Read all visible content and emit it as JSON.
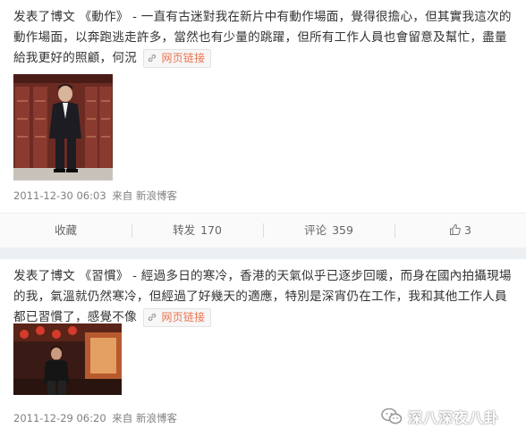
{
  "posts": [
    {
      "text": "发表了博文 《動作》 - 一直有古迷對我在新片中有動作場面，覺得很擔心，但其實我這次的動作場面，以奔跑逃走許多，當然也有少量的跳躍，但所有工作人員也會留意及幫忙，盡量給我更好的照顧，何況",
      "link_label": "网页链接",
      "timestamp": "2011-12-30 06:03",
      "source": "来自 新浪博客"
    },
    {
      "text": "发表了博文 《習慣》 - 經過多日的寒冷，香港的天氣似乎已逐步回暖，而身在國內拍攝現場的我，氣溫就仍然寒冷，但經過了好幾天的適應，特別是深宵仍在工作，我和其他工作人員都已習慣了，感覺不像",
      "link_label": "网页链接",
      "timestamp": "2011-12-29 06:20",
      "source": "来自 新浪博客"
    }
  ],
  "actions": {
    "favorite_label": "收藏",
    "repost_label": "转发",
    "repost_count": "170",
    "comment_label": "评论",
    "comment_count": "359",
    "like_count": "3"
  },
  "watermark": {
    "text": "深八深夜八卦"
  },
  "colors": {
    "link_accent": "#eb7350",
    "meta_gray": "#808080",
    "separator": "#edf0f3"
  },
  "icons": [
    "link-icon",
    "thumbs-up-icon",
    "wechat-icon"
  ]
}
